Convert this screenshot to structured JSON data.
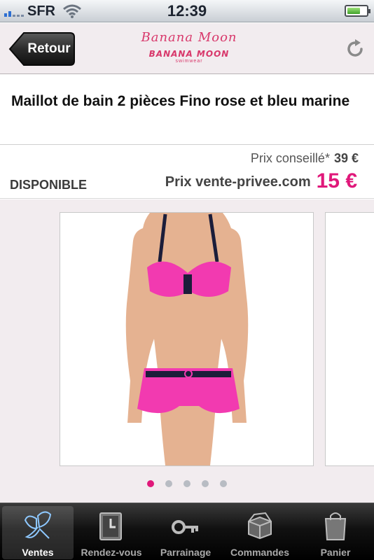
{
  "status_bar": {
    "carrier": "SFR",
    "time": "12:39"
  },
  "header": {
    "back_label": "Retour",
    "logo_script": "Banana Moon",
    "logo_bar": "BANANA MOON",
    "logo_sub": "swimwear"
  },
  "product": {
    "title": "Maillot de bain 2 pièces Fino rose et bleu marine",
    "rrp_label": "Prix conseillé*",
    "rrp_value": "39 €",
    "availability": "DISPONIBLE",
    "price_label": "Prix vente-privee.com",
    "price_value": "15 €"
  },
  "gallery": {
    "image_count": 5,
    "active_index": 0
  },
  "tabs": [
    {
      "label": "Ventes",
      "icon": "butterfly-icon",
      "selected": true
    },
    {
      "label": "Rendez-vous",
      "icon": "clock-icon",
      "selected": false
    },
    {
      "label": "Parrainage",
      "icon": "key-icon",
      "selected": false
    },
    {
      "label": "Commandes",
      "icon": "box-icon",
      "selected": false
    },
    {
      "label": "Panier",
      "icon": "bag-icon",
      "selected": false
    }
  ],
  "colors": {
    "accent": "#e0187a",
    "nav_bg": "#f2ecef"
  }
}
